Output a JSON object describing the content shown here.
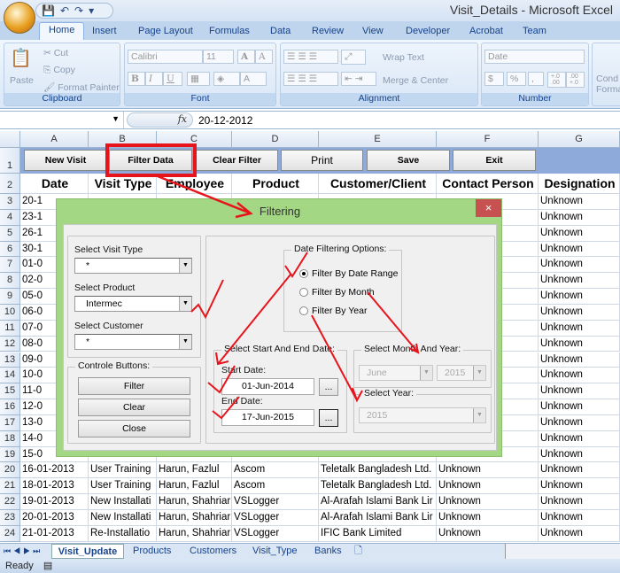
{
  "window": {
    "title": "Visit_Details - Microsoft Excel"
  },
  "ribbon": {
    "tabs": [
      "Home",
      "Insert",
      "Page Layout",
      "Formulas",
      "Data",
      "Review",
      "View",
      "Developer",
      "Acrobat",
      "Team"
    ],
    "clipboard": {
      "label": "Clipboard",
      "paste": "Paste",
      "cut": "Cut",
      "copy": "Copy",
      "format_painter": "Format Painter"
    },
    "font": {
      "label": "Font",
      "name": "Calibri",
      "size": "11",
      "bold": "B",
      "italic": "I",
      "underline": "U",
      "grow": "A",
      "shrink": "A"
    },
    "alignment": {
      "label": "Alignment",
      "wrap": "Wrap Text",
      "merge": "Merge & Center"
    },
    "number": {
      "label": "Number",
      "format": "Date",
      "currency": "$",
      "percent": "%",
      "comma": ",",
      "inc": "+.0 .00",
      "dec": ".00 +.0"
    },
    "styles": {
      "cond": "Cond",
      "forma": "Forma"
    }
  },
  "formula_bar": {
    "name_box": "",
    "fx": "fx",
    "value": "20-12-2012"
  },
  "columns": [
    "A",
    "B",
    "C",
    "D",
    "E",
    "F",
    "G"
  ],
  "sheet_buttons": [
    "New Visit",
    "Filter Data",
    "Clear Filter",
    "Print",
    "Save",
    "Exit"
  ],
  "headers": [
    "Date",
    "Visit Type",
    "Employee",
    "Product",
    "Customer/Client",
    "Contact Person",
    "Designation"
  ],
  "rows": [
    {
      "n": "3",
      "a": "20-1",
      "g": "Unknown"
    },
    {
      "n": "4",
      "a": "23-1",
      "g": "Unknown"
    },
    {
      "n": "5",
      "a": "26-1",
      "g": "Unknown"
    },
    {
      "n": "6",
      "a": "30-1",
      "g": "Unknown"
    },
    {
      "n": "7",
      "a": "01-0",
      "g": "Unknown"
    },
    {
      "n": "8",
      "a": "02-0",
      "g": "Unknown"
    },
    {
      "n": "9",
      "a": "05-0",
      "g": "Unknown"
    },
    {
      "n": "10",
      "a": "06-0",
      "g": "Unknown"
    },
    {
      "n": "11",
      "a": "07-0",
      "g": "Unknown"
    },
    {
      "n": "12",
      "a": "08-0",
      "g": "Unknown"
    },
    {
      "n": "13",
      "a": "09-0",
      "g": "Unknown"
    },
    {
      "n": "14",
      "a": "10-0",
      "g": "Unknown"
    },
    {
      "n": "15",
      "a": "11-0",
      "g": "Unknown"
    },
    {
      "n": "16",
      "a": "12-0",
      "g": "Unknown"
    },
    {
      "n": "17",
      "a": "13-0",
      "g": "Unknown"
    },
    {
      "n": "18",
      "a": "14-0",
      "g": "Unknown"
    },
    {
      "n": "19",
      "a": "15-0",
      "g": "Unknown"
    },
    {
      "n": "20",
      "a": "16-01-2013",
      "b": "User Training",
      "c": "Harun, Fazlul",
      "d": "Ascom",
      "e": "Teletalk Bangladesh Ltd.",
      "f": "Unknown",
      "g": "Unknown"
    },
    {
      "n": "21",
      "a": "18-01-2013",
      "b": "User Training",
      "c": "Harun, Fazlul",
      "d": "Ascom",
      "e": "Teletalk Bangladesh Ltd.",
      "f": "Unknown",
      "g": "Unknown"
    },
    {
      "n": "22",
      "a": "19-01-2013",
      "b": "New Installati",
      "c": "Harun, Shahriar",
      "d": "VSLogger",
      "e": "Al-Arafah Islami Bank Lir",
      "f": "Unknown",
      "g": "Unknown"
    },
    {
      "n": "23",
      "a": "20-01-2013",
      "b": "New Installati",
      "c": "Harun, Shahriar",
      "d": "VSLogger",
      "e": "Al-Arafah Islami Bank Lir",
      "f": "Unknown",
      "g": "Unknown"
    },
    {
      "n": "24",
      "a": "21-01-2013",
      "b": "Re-Installatio",
      "c": "Harun, Shahriar",
      "d": "VSLogger",
      "e": "IFIC Bank Limited",
      "f": "Unknown",
      "g": "Unknown"
    }
  ],
  "row_labels": [
    "1",
    "2"
  ],
  "sheet_tabs": [
    "Visit_Update",
    "Products",
    "Customers",
    "Visit_Type",
    "Banks"
  ],
  "status": "Ready",
  "dialog": {
    "title": "Filtering",
    "close": "×",
    "visit_type_label": "Select Visit Type",
    "visit_type": "*",
    "product_label": "Select Product",
    "product": "Intermec",
    "customer_label": "Select Customer",
    "customer": "*",
    "controls_label": "Controle Buttons:",
    "filter": "Filter",
    "clear": "Clear",
    "close_btn": "Close",
    "options_label": "Date Filtering Options:",
    "options": [
      "Filter By Date Range",
      "Filter By Month",
      "Filter By Year"
    ],
    "selected_option": 0,
    "range_label": "Select Start And End Date:",
    "start_label": "Start Date:",
    "start": "01-Jun-2014",
    "end_label": "End Date:",
    "end": "17-Jun-2015",
    "picker": "...",
    "month_year_label": "Select Month And Year:",
    "month": "June",
    "month_year": "2015",
    "year_label": "Select  Year:",
    "year": "2015"
  }
}
